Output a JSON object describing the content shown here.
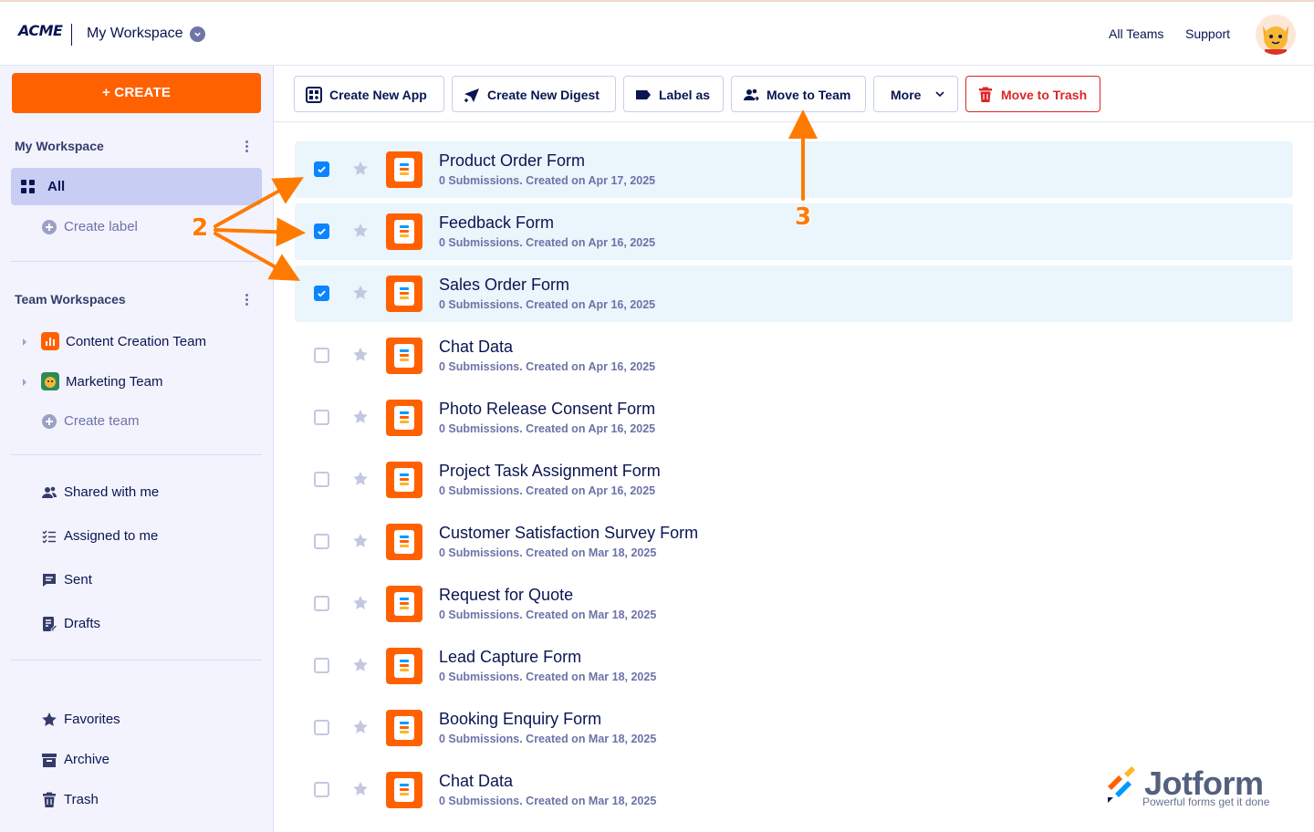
{
  "header": {
    "logo": "ACME",
    "workspace_title": "My Workspace",
    "links": {
      "all_teams": "All Teams",
      "support": "Support"
    }
  },
  "sidebar": {
    "create_label": "+ CREATE",
    "my_workspace_title": "My Workspace",
    "all_label": "All",
    "create_label_text": "Create label",
    "team_workspaces_title": "Team Workspaces",
    "teams": [
      {
        "name": "Content Creation Team",
        "icon": "team-content-icon",
        "color": "#ff6100"
      },
      {
        "name": "Marketing Team",
        "icon": "team-marketing-icon",
        "color": "#2e8b57"
      }
    ],
    "create_team": "Create team",
    "nav": [
      {
        "label": "Shared with me",
        "icon": "users-icon"
      },
      {
        "label": "Assigned to me",
        "icon": "checklist-icon"
      },
      {
        "label": "Sent",
        "icon": "message-icon"
      },
      {
        "label": "Drafts",
        "icon": "draft-icon"
      }
    ],
    "bottom_nav": [
      {
        "label": "Favorites",
        "icon": "star-icon"
      },
      {
        "label": "Archive",
        "icon": "archive-icon"
      },
      {
        "label": "Trash",
        "icon": "trash-icon"
      }
    ]
  },
  "toolbar": {
    "create_app": "Create New App",
    "create_digest": "Create New Digest",
    "label_as": "Label as",
    "move_to_team": "Move to Team",
    "more": "More",
    "move_to_trash": "Move to Trash"
  },
  "forms": [
    {
      "title": "Product Order Form",
      "meta": "0 Submissions. Created on Apr 17, 2025",
      "selected": true
    },
    {
      "title": "Feedback Form",
      "meta": "0 Submissions. Created on Apr 16, 2025",
      "selected": true
    },
    {
      "title": "Sales Order Form",
      "meta": "0 Submissions. Created on Apr 16, 2025",
      "selected": true
    },
    {
      "title": "Chat Data",
      "meta": "0 Submissions. Created on Apr 16, 2025",
      "selected": false
    },
    {
      "title": "Photo Release Consent Form",
      "meta": "0 Submissions. Created on Apr 16, 2025",
      "selected": false
    },
    {
      "title": "Project Task Assignment Form",
      "meta": "0 Submissions. Created on Apr 16, 2025",
      "selected": false
    },
    {
      "title": "Customer Satisfaction Survey Form",
      "meta": "0 Submissions. Created on Mar 18, 2025",
      "selected": false
    },
    {
      "title": "Request for Quote",
      "meta": "0 Submissions. Created on Mar 18, 2025",
      "selected": false
    },
    {
      "title": "Lead Capture Form",
      "meta": "0 Submissions. Created on Mar 18, 2025",
      "selected": false
    },
    {
      "title": "Booking Enquiry Form",
      "meta": "0 Submissions. Created on Mar 18, 2025",
      "selected": false
    },
    {
      "title": "Chat Data",
      "meta": "0 Submissions. Created on Mar 18, 2025",
      "selected": false
    }
  ],
  "annotations": {
    "step_2": "2",
    "step_3": "3"
  },
  "watermark": {
    "brand": "Jotform",
    "tagline": "Powerful forms get it done"
  },
  "colors": {
    "accent": "#ff6100",
    "selected_row": "#eaf5fc",
    "checkbox": "#0a84ff",
    "danger": "#dc2626",
    "arrow": "#ff7a00"
  }
}
